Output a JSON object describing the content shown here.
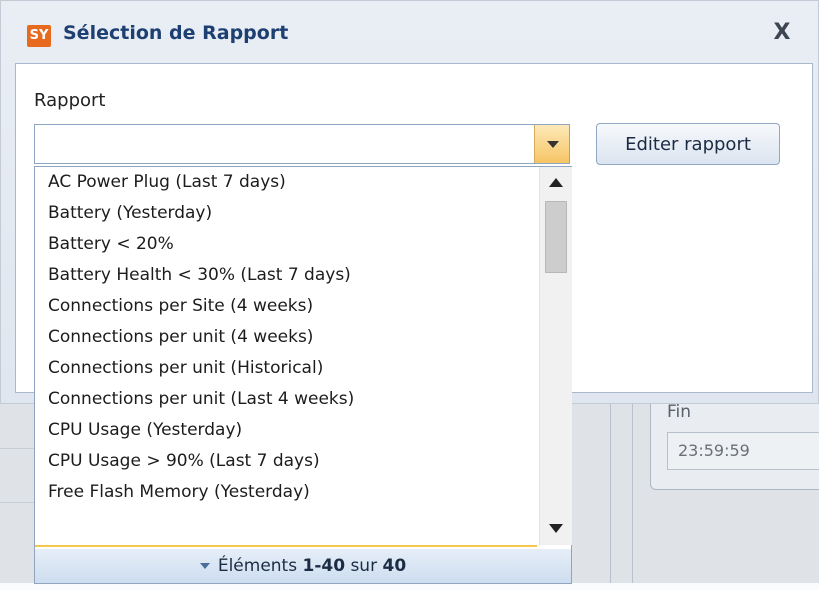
{
  "dialog": {
    "icon_text": "SY",
    "title": "Sélection de Rapport",
    "close_label": "X"
  },
  "form": {
    "rapport_label": "Rapport",
    "combo_value": "",
    "edit_button_label": "Editer rapport"
  },
  "dropdown": {
    "items": [
      "AC Power Plug (Last 7 days)",
      "Battery (Yesterday)",
      "Battery < 20%",
      "Battery Health < 30% (Last 7 days)",
      "Connections per Site (4 weeks)",
      "Connections per unit (4 weeks)",
      "Connections per unit (Historical)",
      "Connections per unit (Last 4 weeks)",
      "CPU Usage (Yesterday)",
      "CPU Usage > 90% (Last 7 days)",
      "Free Flash Memory (Yesterday)"
    ],
    "footer": {
      "prefix": "Éléments",
      "range": "1-40",
      "middle": "sur",
      "total": "40"
    }
  },
  "background": {
    "fin_label": "Fin",
    "fin_value": "23:59:59"
  },
  "colors": {
    "accent_orange": "#e86a1f",
    "title_blue": "#1e3f72",
    "highlight_yellow": "#f4c84f"
  }
}
